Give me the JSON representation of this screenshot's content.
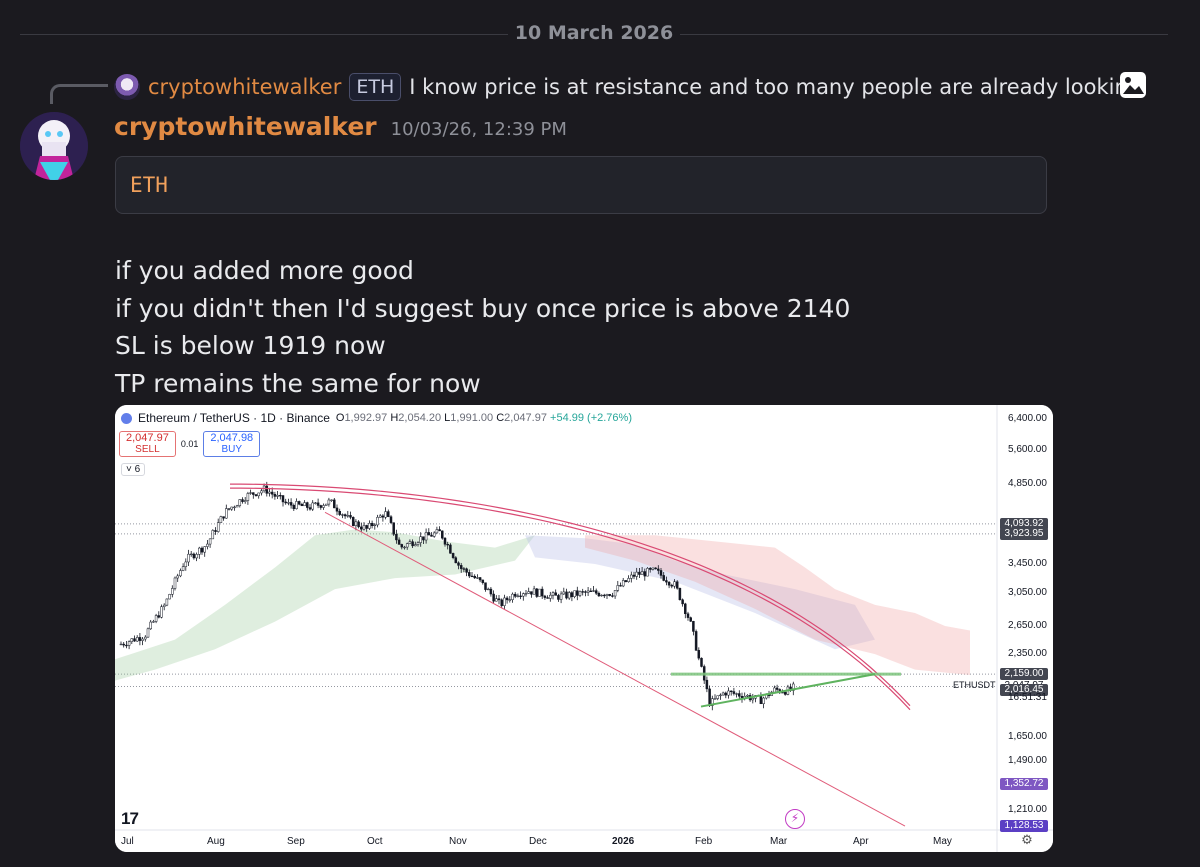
{
  "date_divider": "10 March 2026",
  "reply": {
    "author": "cryptowhitewalker",
    "tag": "ETH",
    "text": "I know price is at resistance and too many people are already lookin..."
  },
  "message": {
    "author": "cryptowhitewalker",
    "timestamp": "10/03/26, 12:39 PM",
    "code_block": "ETH",
    "lines": [
      "if you added more good",
      "if you didn't then I'd suggest buy once price is above 2140",
      "SL is below 1919 now",
      "TP remains the same for now"
    ]
  },
  "chart_data": {
    "type": "candlestick",
    "symbol_line": "Ethereum / TetherUS · 1D · Binance",
    "ohlc": {
      "open_label": "O",
      "open": "1,992.97",
      "high_label": "H",
      "high": "2,054.20",
      "low_label": "L",
      "low": "1,991.00",
      "close_label": "C",
      "close": "2,047.97",
      "change": "+54.99 (+2.76%)"
    },
    "sell_price": "2,047.97",
    "sell_label": "SELL",
    "buy_price": "2,047.98",
    "buy_label": "BUY",
    "spread": "0.01",
    "indicator_count": "6",
    "symbol_tag": "ETHUSDT",
    "countdown": "16:51:31",
    "y_ticks": [
      "6,400.00",
      "5,600.00",
      "4,850.00",
      "3,450.00",
      "3,050.00",
      "2,650.00",
      "2,350.00",
      "1,650.00",
      "1,490.00",
      "1,210.00"
    ],
    "x_ticks": [
      "Jul",
      "Aug",
      "Sep",
      "Oct",
      "Nov",
      "Dec",
      "2026",
      "Feb",
      "Mar",
      "Apr",
      "May"
    ],
    "price_badges": [
      {
        "value": "4,093.92",
        "color": "#434651"
      },
      {
        "value": "3,923.95",
        "color": "#434651"
      },
      {
        "value": "2,159.00",
        "color": "#434651"
      },
      {
        "value": "2,047.97",
        "color": "#ffffff"
      },
      {
        "value": "2,016.45",
        "color": "#434651"
      },
      {
        "value": "1,352.72",
        "color": "#7e57c2"
      },
      {
        "value": "1,128.53",
        "color": "#5b3fc4"
      }
    ],
    "series_close_approx": [
      {
        "x": "Jul",
        "y": 2450
      },
      {
        "x": "Aug",
        "y": 3700
      },
      {
        "x": "Aug-late",
        "y": 4850
      },
      {
        "x": "Sep",
        "y": 4400
      },
      {
        "x": "Oct",
        "y": 4300
      },
      {
        "x": "Oct-mid",
        "y": 3900
      },
      {
        "x": "Nov",
        "y": 3400
      },
      {
        "x": "Nov-late",
        "y": 2800
      },
      {
        "x": "Dec",
        "y": 3050
      },
      {
        "x": "2026",
        "y": 3000
      },
      {
        "x": "Jan-mid",
        "y": 3300
      },
      {
        "x": "Feb",
        "y": 2300
      },
      {
        "x": "Feb-mid",
        "y": 1950
      },
      {
        "x": "Mar",
        "y": 2047.97
      }
    ],
    "colors": {
      "up": "#26a69a",
      "down": "#131722",
      "resistance": "#4caf50",
      "trendline": "#e05c7a"
    }
  }
}
